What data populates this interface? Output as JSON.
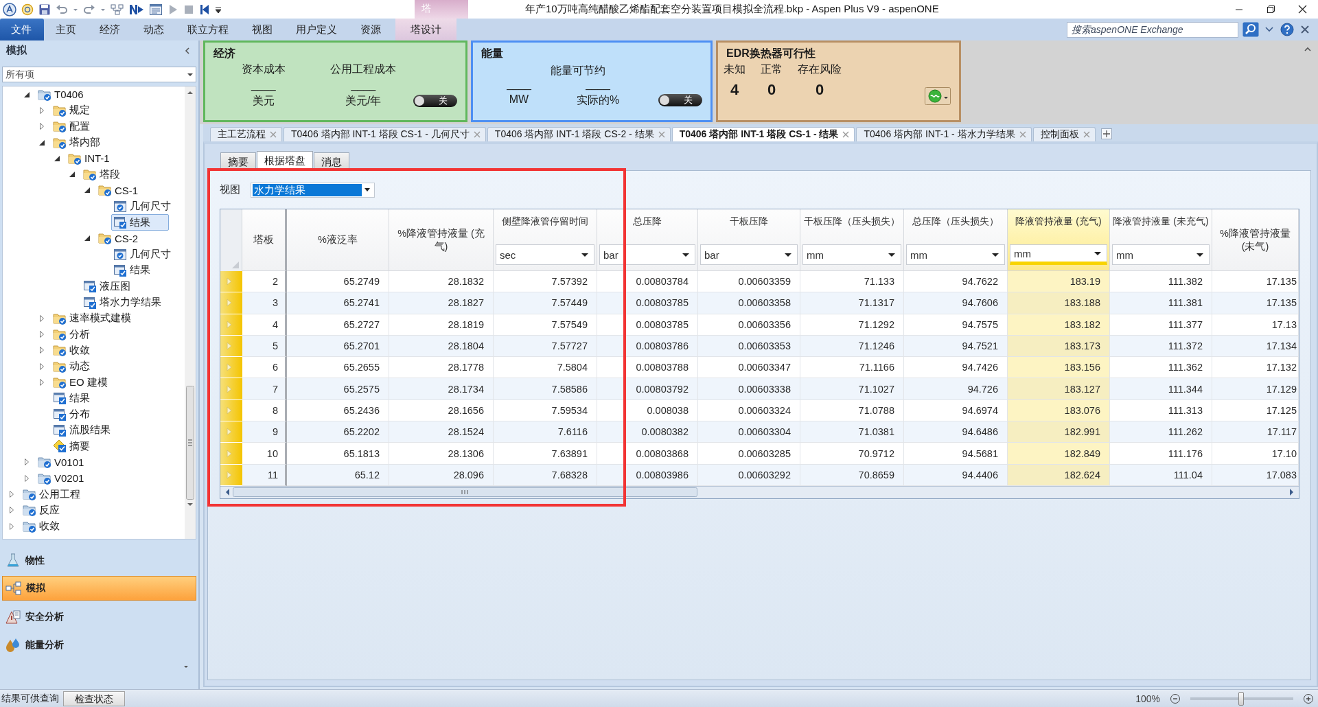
{
  "title_bar": {
    "title": "年产10万吨高纯醋酸乙烯酯配套空分装置项目模拟全流程.bkp - Aspen Plus V9 - aspenONE",
    "context_group": "塔"
  },
  "ribbon": {
    "tabs": [
      {
        "label": "文件",
        "kind": "file"
      },
      {
        "label": "主页",
        "kind": "tab"
      },
      {
        "label": "经济",
        "kind": "tab"
      },
      {
        "label": "动态",
        "kind": "tab"
      },
      {
        "label": "联立方程",
        "kind": "tab"
      },
      {
        "label": "视图",
        "kind": "tab"
      },
      {
        "label": "用户定义",
        "kind": "tab"
      },
      {
        "label": "资源",
        "kind": "tab"
      },
      {
        "label": "塔设计",
        "kind": "context"
      }
    ],
    "search": {
      "placeholder": "搜索aspenONE Exchange"
    }
  },
  "navigator": {
    "title": "模拟",
    "filter": "所有项",
    "tree": [
      {
        "children": [
          {
            "label": "T0406",
            "kind": "block",
            "expanded": true,
            "selected": false,
            "children": [
              {
                "label": "规定",
                "kind": "folder",
                "expanded": false,
                "selected": false
              },
              {
                "label": "配置",
                "kind": "folder",
                "expanded": false,
                "selected": false
              },
              {
                "label": "塔内部",
                "kind": "folder",
                "expanded": true,
                "selected": false,
                "children": [
                  {
                    "label": "INT-1",
                    "kind": "folder",
                    "expanded": true,
                    "selected": false,
                    "children": [
                      {
                        "label": "塔段",
                        "kind": "folder",
                        "expanded": true,
                        "selected": false,
                        "children": [
                          {
                            "label": "CS-1",
                            "kind": "folder",
                            "expanded": true,
                            "selected": false,
                            "children": [
                              {
                                "label": "几何尺寸",
                                "kind": "form",
                                "selected": false
                              },
                              {
                                "label": "结果",
                                "kind": "results",
                                "selected": true
                              }
                            ]
                          },
                          {
                            "label": "CS-2",
                            "kind": "folder",
                            "expanded": true,
                            "selected": false,
                            "children": [
                              {
                                "label": "几何尺寸",
                                "kind": "form",
                                "selected": false
                              },
                              {
                                "label": "结果",
                                "kind": "results",
                                "selected": false
                              }
                            ]
                          }
                        ]
                      },
                      {
                        "label": "液压图",
                        "kind": "results",
                        "selected": false
                      },
                      {
                        "label": "塔水力学结果",
                        "kind": "results",
                        "selected": false
                      }
                    ]
                  }
                ]
              },
              {
                "label": "速率模式建模",
                "kind": "folder",
                "expanded": false,
                "selected": false
              },
              {
                "label": "分析",
                "kind": "folder",
                "expanded": false,
                "selected": false
              },
              {
                "label": "收敛",
                "kind": "folder",
                "expanded": false,
                "selected": false
              },
              {
                "label": "动态",
                "kind": "folder",
                "expanded": false,
                "selected": false
              },
              {
                "label": "EO 建模",
                "kind": "folder",
                "expanded": false,
                "selected": false
              },
              {
                "label": "结果",
                "kind": "results",
                "selected": false
              },
              {
                "label": "分布",
                "kind": "results",
                "selected": false
              },
              {
                "label": "流股结果",
                "kind": "results",
                "selected": false
              },
              {
                "label": "摘要",
                "kind": "summary",
                "selected": false
              }
            ]
          },
          {
            "label": "V0101",
            "kind": "block",
            "expanded": false,
            "selected": false
          },
          {
            "label": "V0201",
            "kind": "block",
            "expanded": false,
            "selected": false
          }
        ]
      },
      {
        "label": "公用工程",
        "kind": "block",
        "expanded": false,
        "selected": false
      },
      {
        "label": "反应",
        "kind": "block",
        "expanded": false,
        "selected": false
      },
      {
        "label": "收敛",
        "kind": "block",
        "expanded": false,
        "selected": false
      }
    ]
  },
  "nav_panes": [
    {
      "label": "物性",
      "kind": "properties",
      "selected": false
    },
    {
      "label": "模拟",
      "kind": "simulation",
      "selected": true
    },
    {
      "label": "安全分析",
      "kind": "safety",
      "selected": false
    },
    {
      "label": "能量分析",
      "kind": "energy",
      "selected": false
    }
  ],
  "dashboard": {
    "economics": {
      "title": "经济",
      "metrics": [
        {
          "label": "资本成本",
          "value": "____",
          "unit": "美元"
        },
        {
          "label": "公用工程成本",
          "value": "____",
          "unit": "美元/年"
        }
      ],
      "toggle": {
        "label": "关",
        "on": false
      }
    },
    "energy": {
      "title": "能量",
      "label": "能量可节约",
      "metrics": [
        {
          "value": "____",
          "unit": "MW"
        },
        {
          "value": "____",
          "unit": "实际的%"
        }
      ],
      "toggle": {
        "label": "关",
        "on": false
      }
    },
    "edr": {
      "title": "EDR换热器可行性",
      "counts": [
        {
          "label": "未知",
          "value": "4"
        },
        {
          "label": "正常",
          "value": "0"
        },
        {
          "label": "存在风险",
          "value": "0"
        }
      ]
    }
  },
  "doc_tabs": [
    {
      "label": "主工艺流程",
      "selected": false
    },
    {
      "label": "T0406 塔内部 INT-1 塔段 CS-1 - 几何尺寸",
      "selected": false
    },
    {
      "label": "T0406 塔内部 INT-1 塔段 CS-2 - 结果",
      "selected": false
    },
    {
      "label": "T0406 塔内部 INT-1 塔段 CS-1 - 结果",
      "selected": true
    },
    {
      "label": "T0406 塔内部 INT-1 - 塔水力学结果",
      "selected": false
    },
    {
      "label": "控制面板",
      "selected": false
    }
  ],
  "form_tabs": [
    {
      "label": "摘要",
      "selected": false
    },
    {
      "label": "根据塔盘",
      "selected": true
    },
    {
      "label": "消息",
      "selected": false
    }
  ],
  "view": {
    "label": "视图",
    "value": "水力学结果"
  },
  "table": {
    "columns": [
      {
        "header": "塔板",
        "highlighted": false
      },
      {
        "header": "%液泛率",
        "highlighted": false
      },
      {
        "header": "%降液管持液量 (充气)",
        "highlighted": false
      },
      {
        "header": "侧壁降液管停留时间",
        "unit": "sec",
        "highlighted": false
      },
      {
        "header": "总压降",
        "unit": "bar",
        "highlighted": false
      },
      {
        "header": "干板压降",
        "unit": "bar",
        "highlighted": false
      },
      {
        "header": "干板压降（压头损失）",
        "unit": "mm",
        "highlighted": false
      },
      {
        "header": "总压降（压头损失）",
        "unit": "mm",
        "highlighted": false
      },
      {
        "header": "降液管持液量 (充气)",
        "unit": "mm",
        "highlighted": true
      },
      {
        "header": "降液管持液量 (未充气)",
        "unit": "mm",
        "highlighted": false
      },
      {
        "header": "%降液管持液量 (未气)",
        "highlighted": false
      }
    ],
    "rows": [
      {
        "cells": [
          "2",
          "65.2749",
          "28.1832",
          "7.57392",
          "0.00803784",
          "0.00603359",
          "71.133",
          "94.7622",
          "183.19",
          "111.382",
          "17.135"
        ]
      },
      {
        "cells": [
          "3",
          "65.2741",
          "28.1827",
          "7.57449",
          "0.00803785",
          "0.00603358",
          "71.1317",
          "94.7606",
          "183.188",
          "111.381",
          "17.135"
        ]
      },
      {
        "cells": [
          "4",
          "65.2727",
          "28.1819",
          "7.57549",
          "0.00803785",
          "0.00603356",
          "71.1292",
          "94.7575",
          "183.182",
          "111.377",
          "17.13"
        ]
      },
      {
        "cells": [
          "5",
          "65.2701",
          "28.1804",
          "7.57727",
          "0.00803786",
          "0.00603353",
          "71.1246",
          "94.7521",
          "183.173",
          "111.372",
          "17.134"
        ]
      },
      {
        "cells": [
          "6",
          "65.2655",
          "28.1778",
          "7.5804",
          "0.00803788",
          "0.00603347",
          "71.1166",
          "94.7426",
          "183.156",
          "111.362",
          "17.132"
        ]
      },
      {
        "cells": [
          "7",
          "65.2575",
          "28.1734",
          "7.58586",
          "0.00803792",
          "0.00603338",
          "71.1027",
          "94.726",
          "183.127",
          "111.344",
          "17.129"
        ]
      },
      {
        "cells": [
          "8",
          "65.2436",
          "28.1656",
          "7.59534",
          "0.008038",
          "0.00603324",
          "71.0788",
          "94.6974",
          "183.076",
          "111.313",
          "17.125"
        ]
      },
      {
        "cells": [
          "9",
          "65.2202",
          "28.1524",
          "7.6116",
          "0.0080382",
          "0.00603304",
          "71.0381",
          "94.6486",
          "182.991",
          "111.262",
          "17.117"
        ]
      },
      {
        "cells": [
          "10",
          "65.1813",
          "28.1306",
          "7.63891",
          "0.00803868",
          "0.00603285",
          "70.9712",
          "94.5681",
          "182.849",
          "111.176",
          "17.10"
        ]
      },
      {
        "cells": [
          "11",
          "65.12",
          "28.096",
          "7.68328",
          "0.00803986",
          "0.00603292",
          "70.8659",
          "94.4406",
          "182.624",
          "111.04",
          "17.083"
        ]
      }
    ]
  },
  "status_bar": {
    "message": "结果可供查询",
    "button": "检查状态",
    "zoom": "100%",
    "zoom_slider": {
      "level": 0.49
    }
  }
}
